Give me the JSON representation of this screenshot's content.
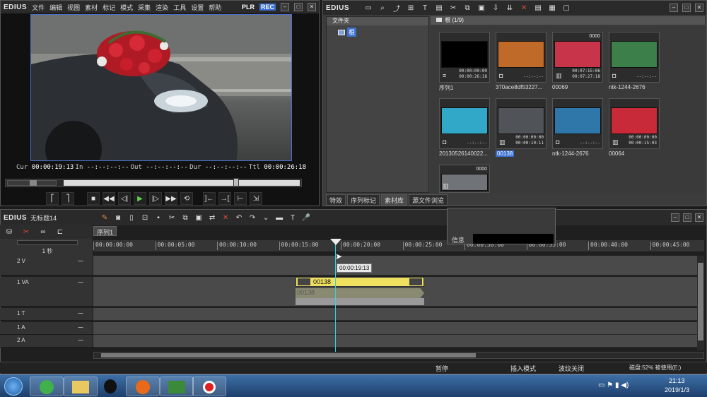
{
  "player": {
    "logo": "EDIUS",
    "menu": [
      "文件",
      "编辑",
      "视图",
      "素材",
      "标记",
      "模式",
      "采集",
      "渲染",
      "工具",
      "设置",
      "帮助"
    ],
    "mode_plr": "PLR",
    "mode_rec": "REC",
    "cur_label": "Cur",
    "cur_value": "00:00:19:13",
    "in_label": "In",
    "in_value": "--:--:--:--",
    "out_label": "Out",
    "out_value": "--:--:--:--",
    "dur_label": "Dur",
    "dur_value": "--:--:--:--",
    "ttl_label": "Ttl",
    "ttl_value": "00:00:26:18"
  },
  "bin": {
    "logo": "EDIUS",
    "tree_header": "文件夹",
    "tree_root": "根",
    "clips_header": "根 (1/9)",
    "clips": [
      {
        "name": "序列1",
        "num": "",
        "tc1": "00:00:00:00",
        "tc2": "00:00:26:18",
        "type": "sequence",
        "color": "#000000",
        "selected": false
      },
      {
        "name": "370ace8df53227...",
        "num": "",
        "tc1": "--:--:--",
        "tc2": "",
        "type": "still",
        "color": "#c06a2a",
        "selected": false
      },
      {
        "name": "00069",
        "num": "0000",
        "tc1": "00:07:15:06",
        "tc2": "00:07:27:18",
        "type": "video",
        "color": "#c8344a",
        "selected": false
      },
      {
        "name": "ntk-1244-2676",
        "num": "",
        "tc1": "--:--:--",
        "tc2": "",
        "type": "still",
        "color": "#3c7f4a",
        "selected": false
      },
      {
        "name": "20130526140022...",
        "num": "",
        "tc1": "--:--:--",
        "tc2": "",
        "type": "still",
        "color": "#32a8c8",
        "selected": false
      },
      {
        "name": "00138",
        "num": "",
        "tc1": "00:00:00:00",
        "tc2": "00:00:10:11",
        "type": "video",
        "color": "#505458",
        "selected": true
      },
      {
        "name": "ntk-1244-2676",
        "num": "",
        "tc1": "--:--:--",
        "tc2": "",
        "type": "still",
        "color": "#2f77a8",
        "selected": false
      },
      {
        "name": "00064",
        "num": "",
        "tc1": "00:00:00:00",
        "tc2": "00:00:15:03",
        "type": "video",
        "color": "#c82a3a",
        "selected": false
      },
      {
        "name": "",
        "num": "0000",
        "tc1": "",
        "tc2": "",
        "type": "video",
        "color": "#707478",
        "selected": false
      }
    ],
    "tabs": [
      "特效",
      "序列标记",
      "素材库",
      "源文件浏览"
    ]
  },
  "timeline": {
    "logo": "EDIUS",
    "project": "无标题14",
    "sequence_tab": "序列1",
    "scale": "1 秒",
    "info_label": "信息",
    "ruler": [
      "00:00:00:00",
      "00:00:05:00",
      "00:00:10:00",
      "00:00:15:00",
      "00:00:20:00",
      "00:00:25:00",
      "00:00:30:00",
      "00:00:35:00",
      "00:00:40:00",
      "00:00:45:00"
    ],
    "cursor_tc": "00:00:19:13",
    "tracks": [
      {
        "name": "2 V"
      },
      {
        "name": "1 VA"
      },
      {
        "name": "1 T"
      },
      {
        "name": "1 A"
      },
      {
        "name": "2 A"
      }
    ],
    "clip_name": "00138",
    "clip_audio_name": "00138"
  },
  "status": {
    "pause": "暂停",
    "insert": "插入模式",
    "ripple": "波纹关闭",
    "disk": "磁盘:52% 被使用(E:)"
  },
  "taskbar": {
    "time": "21:13",
    "date": "2019/1/3"
  }
}
